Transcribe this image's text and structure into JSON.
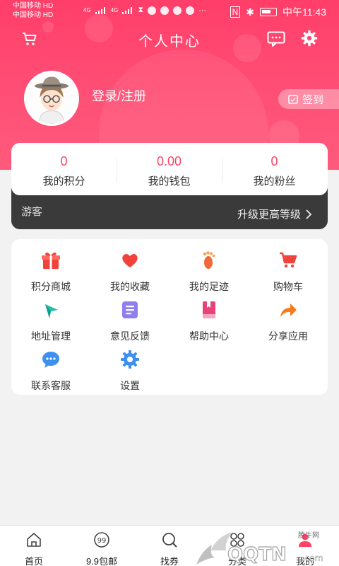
{
  "status_bar": {
    "carrier_line1": "中国移动 HD",
    "carrier_line2": "中国移动 HD",
    "network_1": "4G",
    "network_2": "4G",
    "more": "···",
    "time": "中午11:43"
  },
  "header": {
    "title": "个人中心",
    "cart_icon": "cart-icon",
    "message_icon": "message-icon",
    "settings_icon": "gear-icon"
  },
  "profile": {
    "login_label": "登录/注册",
    "checkin_label": "签到"
  },
  "stats": [
    {
      "value": "0",
      "label": "我的积分"
    },
    {
      "value": "0.00",
      "label": "我的钱包"
    },
    {
      "value": "0",
      "label": "我的粉丝"
    }
  ],
  "membership": {
    "level": "游客",
    "upgrade_label": "升级更高等级"
  },
  "menu": [
    {
      "label": "积分商城",
      "icon": "gift-icon",
      "color": "#f0433c"
    },
    {
      "label": "我的收藏",
      "icon": "heart-icon",
      "color": "#f0433c"
    },
    {
      "label": "我的足迹",
      "icon": "footprint-icon",
      "color": "#f26a3b"
    },
    {
      "label": "购物车",
      "icon": "cart-icon",
      "color": "#f0433c"
    },
    {
      "label": "地址管理",
      "icon": "compass-icon",
      "color": "#1fbfa6"
    },
    {
      "label": "意见反馈",
      "icon": "feedback-icon",
      "color": "#8e7ef0"
    },
    {
      "label": "帮助中心",
      "icon": "book-icon",
      "color": "#e8427a"
    },
    {
      "label": "分享应用",
      "icon": "share-icon",
      "color": "#f77b1e"
    },
    {
      "label": "联系客服",
      "icon": "chat-icon",
      "color": "#3d8ff0"
    },
    {
      "label": "设置",
      "icon": "settings-icon",
      "color": "#3d8ff0"
    }
  ],
  "tabs": [
    {
      "label": "首页",
      "icon": "home-icon"
    },
    {
      "label": "9.9包邮",
      "icon": "coupon-99-icon"
    },
    {
      "label": "找券",
      "icon": "search-icon"
    },
    {
      "label": "分类",
      "icon": "category-icon"
    },
    {
      "label": "我的",
      "icon": "profile-icon"
    }
  ],
  "watermark": {
    "site": "腾牛网",
    "brand": "QQTN",
    "domain": ".com"
  },
  "colors": {
    "brand": "#ff4266",
    "accent_text": "#ff4466",
    "vip_bar": "#3a3a3a",
    "page_bg": "#f2f2f2"
  }
}
